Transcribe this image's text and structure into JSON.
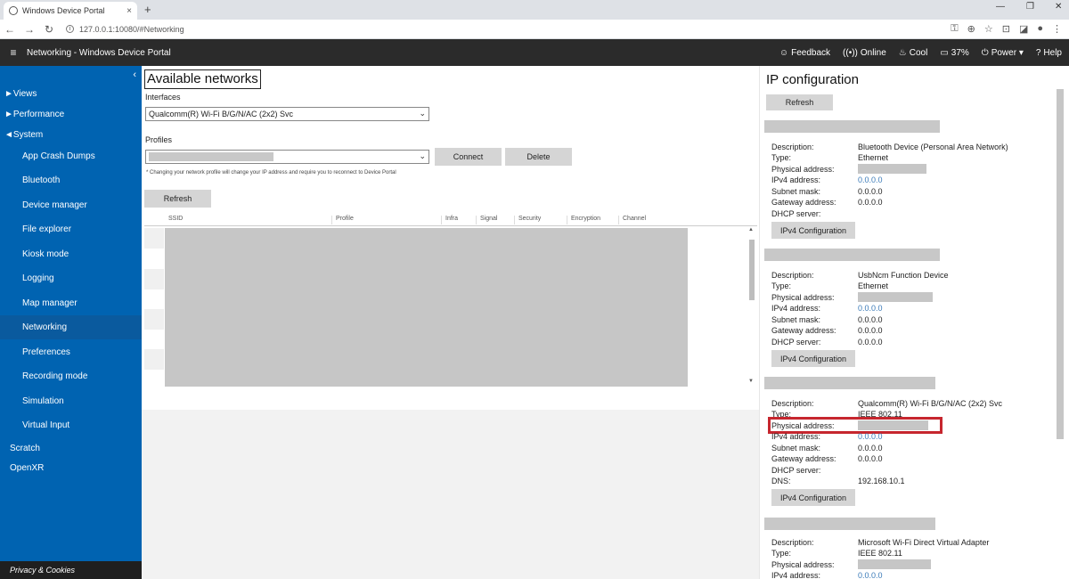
{
  "browser": {
    "tab_title": "Windows Device Portal",
    "tab_close": "×",
    "new_tab": "+",
    "url": "127.0.0.1:10080/#Networking",
    "window_controls": [
      "—",
      "❐",
      "✕"
    ],
    "nav_buttons": [
      "←",
      "→",
      "↻"
    ],
    "toolbar_icons": [
      "⚿",
      "⊕",
      "☆",
      "⊡",
      "◪",
      "●",
      "⋮"
    ]
  },
  "header": {
    "menu_icon": "≡",
    "title": "Networking - Windows Device Portal",
    "items": [
      {
        "icon": "☺",
        "label": "Feedback"
      },
      {
        "icon": "((•))",
        "label": "Online"
      },
      {
        "icon": "♨",
        "label": "Cool"
      },
      {
        "icon": "▭",
        "label": "37%"
      },
      {
        "icon": "⏻",
        "label": "Power ▾"
      },
      {
        "icon": "?",
        "label": "Help"
      }
    ]
  },
  "sidebar": {
    "collapse_icon": "‹",
    "top_items": [
      "►Views",
      "►Performance",
      "◄System"
    ],
    "sub_items": [
      "App Crash Dumps",
      "Bluetooth",
      "Device manager",
      "File explorer",
      "Kiosk mode",
      "Logging",
      "Map manager",
      "Networking",
      "Preferences",
      "Recording mode",
      "Simulation",
      "Virtual Input"
    ],
    "active_item": "Networking",
    "bottom_items": [
      "Scratch",
      "OpenXR"
    ],
    "privacy": "Privacy & Cookies"
  },
  "main": {
    "title": "Available networks",
    "interfaces_label": "Interfaces",
    "interface_selected": "Qualcomm(R) Wi-Fi B/G/N/AC (2x2) Svc",
    "profiles_label": "Profiles",
    "connect_label": "Connect",
    "delete_label": "Delete",
    "note": "* Changing your network profile will change your IP address and require you to reconnect to Device Portal",
    "refresh_label": "Refresh",
    "columns": [
      "SSID",
      "Profile",
      "Infra",
      "Signal",
      "Security",
      "Encryption",
      "Channel"
    ]
  },
  "ip_config": {
    "title": "IP configuration",
    "refresh_label": "Refresh",
    "ipv4_button": "IPv4 Configuration",
    "adapters": [
      {
        "rows": [
          {
            "k": "Description:",
            "v": "Bluetooth Device (Personal Area Network)"
          },
          {
            "k": "Type:",
            "v": "Ethernet"
          },
          {
            "k": "Physical address:",
            "v": ""
          },
          {
            "k": "IPv4 address:",
            "v": "0.0.0.0"
          },
          {
            "k": "Subnet mask:",
            "v": "0.0.0.0"
          },
          {
            "k": "Gateway address:",
            "v": "0.0.0.0"
          },
          {
            "k": "DHCP server:",
            "v": ""
          }
        ]
      },
      {
        "rows": [
          {
            "k": "Description:",
            "v": "UsbNcm Function Device"
          },
          {
            "k": "Type:",
            "v": "Ethernet"
          },
          {
            "k": "Physical address:",
            "v": ""
          },
          {
            "k": "IPv4 address:",
            "v": "0.0.0.0"
          },
          {
            "k": "Subnet mask:",
            "v": "0.0.0.0"
          },
          {
            "k": "Gateway address:",
            "v": "0.0.0.0"
          },
          {
            "k": "DHCP server:",
            "v": "0.0.0.0"
          }
        ]
      },
      {
        "rows": [
          {
            "k": "Description:",
            "v": "Qualcomm(R) Wi-Fi B/G/N/AC (2x2) Svc"
          },
          {
            "k": "Type:",
            "v": "IEEE 802.11"
          },
          {
            "k": "Physical address:",
            "v": ""
          },
          {
            "k": "IPv4 address:",
            "v": "0.0.0.0"
          },
          {
            "k": "Subnet mask:",
            "v": "0.0.0.0"
          },
          {
            "k": "Gateway address:",
            "v": "0.0.0.0"
          },
          {
            "k": "DHCP server:",
            "v": ""
          },
          {
            "k": "DNS:",
            "v": "192.168.10.1"
          }
        ]
      },
      {
        "rows": [
          {
            "k": "Description:",
            "v": "Microsoft Wi-Fi Direct Virtual Adapter"
          },
          {
            "k": "Type:",
            "v": "IEEE 802.11"
          },
          {
            "k": "Physical address:",
            "v": ""
          },
          {
            "k": "IPv4 address:",
            "v": "0.0.0.0"
          }
        ]
      }
    ]
  },
  "colors": {
    "sidebar": "#0063b1",
    "header": "#2b2b2b",
    "highlight": "#c6262e",
    "link": "#3a7ab8"
  }
}
